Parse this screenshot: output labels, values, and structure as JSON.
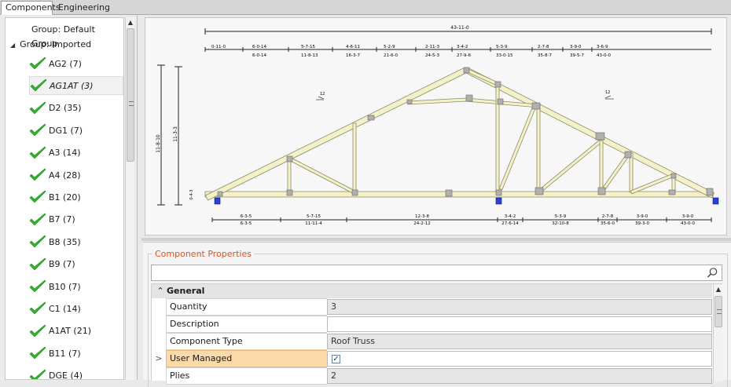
{
  "tabs": [
    {
      "label": "Components",
      "active": true
    },
    {
      "label": "Engineering",
      "active": false
    }
  ],
  "tree": {
    "groups": [
      {
        "label": "Group: Default Group",
        "expanded": false
      },
      {
        "label": "Group: Imported",
        "expanded": true
      }
    ],
    "items": [
      {
        "label": "AG2 (7)"
      },
      {
        "label": "AG1AT (3)",
        "selected": true
      },
      {
        "label": "D2 (35)"
      },
      {
        "label": "DG1 (7)"
      },
      {
        "label": "A3 (14)"
      },
      {
        "label": "A4 (28)"
      },
      {
        "label": "B1 (20)"
      },
      {
        "label": "B7 (7)"
      },
      {
        "label": "B8 (35)"
      },
      {
        "label": "B9 (7)"
      },
      {
        "label": "B10 (7)"
      },
      {
        "label": "C1 (14)"
      },
      {
        "label": "A1AT (21)"
      },
      {
        "label": "B11 (7)"
      },
      {
        "label": "DGE (4)"
      }
    ]
  },
  "drawing": {
    "overall_span": "43-11-0",
    "top_dims": [
      "0-11-0",
      "6-0-14",
      "5-7-15",
      "4-6-11",
      "5-2-9",
      "2-11-3",
      "3-4-2",
      "5-3-9",
      "2-7-8",
      "3-9-0",
      "3-6-9"
    ],
    "top_cumulative": [
      "6-0-14",
      "11-8-13",
      "16-3-7",
      "21-6-0",
      "24-5-3",
      "27-9-6",
      "33-0-15",
      "35-8-7",
      "39-5-7",
      "43-0-0"
    ],
    "bottom_dims": [
      "6-3-5",
      "5-7-15",
      "12-3-8",
      "3-4-2",
      "5-3-9",
      "2-7-8",
      "3-9-0",
      "3-9-0"
    ],
    "bottom_cumulative": [
      "6-3-5",
      "11-11-4",
      "24-2-12",
      "27-6-14",
      "32-10-8",
      "35-6-0",
      "39-3-0",
      "43-0-0"
    ],
    "height_total": "11-8-10",
    "height_inner": "11-3-3",
    "heel": "0-4-3",
    "pitch_left": "12",
    "pitch_right": "12",
    "colors": {
      "lumber": "#f4f0c8",
      "lumber_stroke": "#8c8b6a",
      "plate": "#b0b0b0",
      "bearing": "#2a3fd6"
    }
  },
  "properties": {
    "title": "Component Properties",
    "search_placeholder": "",
    "section": "General",
    "rows": [
      {
        "name": "Quantity",
        "value": "3",
        "editable": false
      },
      {
        "name": "Description",
        "value": "",
        "editable": true
      },
      {
        "name": "Component Type",
        "value": "Roof Truss",
        "editable": false
      },
      {
        "name": "User Managed",
        "value": "",
        "checkbox": true,
        "checked": true,
        "active": true
      },
      {
        "name": "Plies",
        "value": "2",
        "editable": false
      }
    ]
  }
}
